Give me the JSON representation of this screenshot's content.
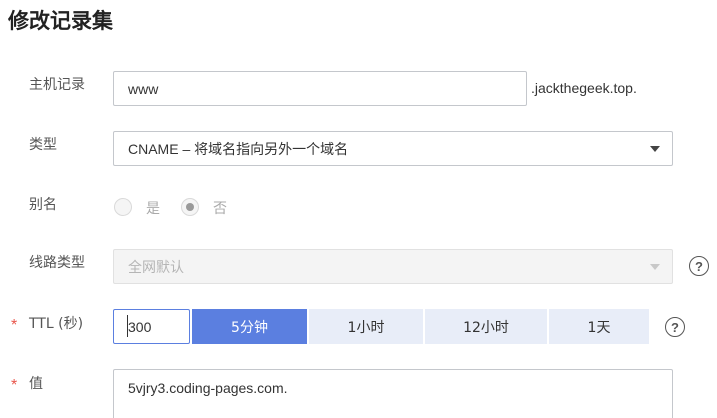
{
  "page_title": "修改记录集",
  "host": {
    "label": "主机记录",
    "value": "www",
    "suffix": ".jackthegeek.top."
  },
  "type": {
    "label": "类型",
    "selected": "CNAME – 将域名指向另外一个域名"
  },
  "alias": {
    "label": "别名",
    "option_yes": "是",
    "option_no": "否",
    "selected": "否"
  },
  "line_type": {
    "label": "线路类型",
    "selected": "全网默认",
    "help_glyph": "?"
  },
  "ttl": {
    "required_mark": "*",
    "label": "TTL (秒)",
    "value": "300",
    "presets": [
      "5分钟",
      "1小时",
      "12小时",
      "1天"
    ],
    "active_preset": "5分钟",
    "help_glyph": "?"
  },
  "value_field": {
    "required_mark": "*",
    "label": "值",
    "value": "5vjry3.coding-pages.com."
  },
  "colors": {
    "accent": "#5b7fe0",
    "preset_bg": "#e8edf8",
    "required": "#e8564c"
  }
}
